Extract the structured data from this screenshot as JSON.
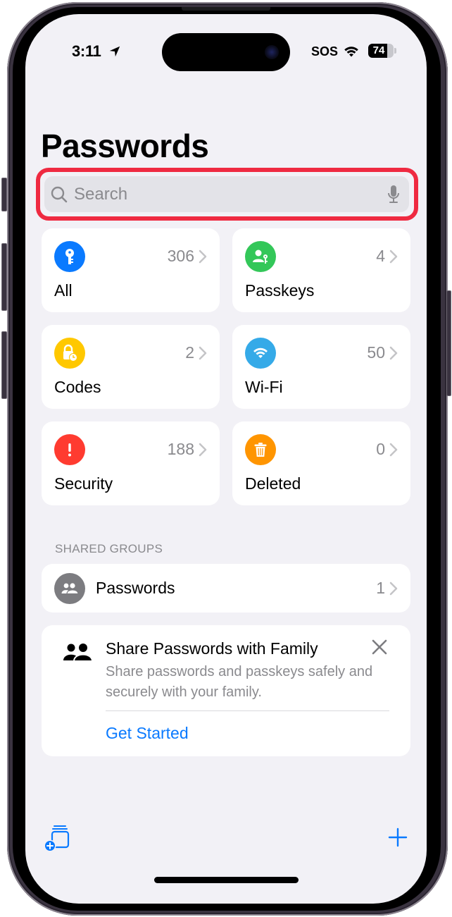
{
  "status_bar": {
    "time": "3:11",
    "carrier": "SOS",
    "battery_percent": "74",
    "battery_level": 0.74
  },
  "header": {
    "title": "Passwords"
  },
  "search": {
    "placeholder": "Search"
  },
  "categories": [
    {
      "label": "All",
      "count": "306",
      "icon": "key-icon",
      "color": "#0a7aff"
    },
    {
      "label": "Passkeys",
      "count": "4",
      "icon": "person-key-icon",
      "color": "#33c759"
    },
    {
      "label": "Codes",
      "count": "2",
      "icon": "lock-clock-icon",
      "color": "#ffc800"
    },
    {
      "label": "Wi-Fi",
      "count": "50",
      "icon": "wifi-icon",
      "color": "#35aae8"
    },
    {
      "label": "Security",
      "count": "188",
      "icon": "exclamation-icon",
      "color": "#ff3b30"
    },
    {
      "label": "Deleted",
      "count": "0",
      "icon": "trash-icon",
      "color": "#ff9500"
    }
  ],
  "shared_groups": {
    "header": "SHARED GROUPS",
    "items": [
      {
        "label": "Passwords",
        "count": "1",
        "icon": "group-icon"
      }
    ]
  },
  "share_card": {
    "title": "Share Passwords with Family",
    "description": "Share passwords and passkeys safely and securely with your family.",
    "action": "Get Started"
  },
  "toolbar": {
    "left_icon": "new-shared-group-icon",
    "right_icon": "plus-icon"
  },
  "colors": {
    "accent": "#0a7aff",
    "highlight": "#ef2a41",
    "background": "#f2f1f6",
    "secondary_text": "#8a8a8e"
  }
}
